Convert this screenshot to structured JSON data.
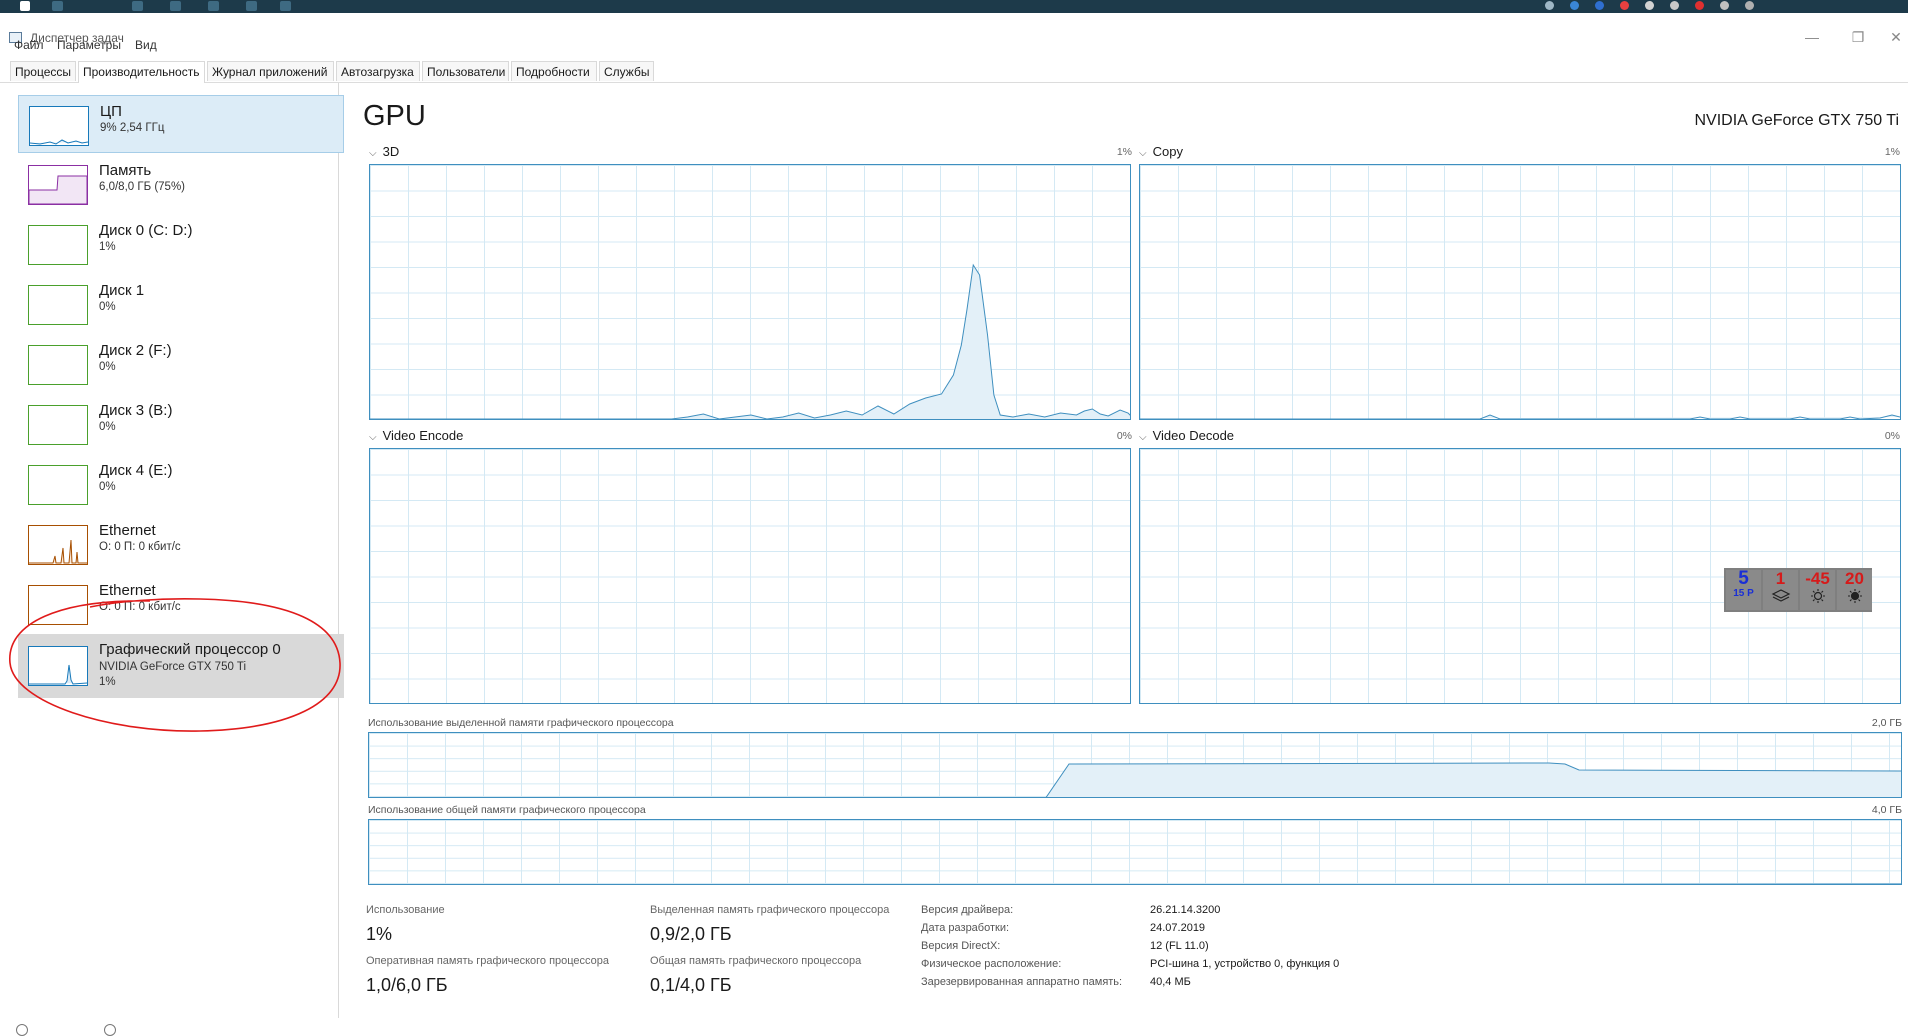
{
  "window": {
    "title": "Диспетчер задач"
  },
  "menu": [
    "Файл",
    "Параметры",
    "Вид"
  ],
  "tabs": [
    "Процессы",
    "Производительность",
    "Журнал приложений",
    "Автозагрузка",
    "Пользователи",
    "Подробности",
    "Службы"
  ],
  "sidebar": {
    "items": [
      {
        "name": "ЦП",
        "line1": "9% 2,54 ГГц",
        "color": "#1779ba"
      },
      {
        "name": "Память",
        "line1": "6,0/8,0 ГБ (75%)",
        "color": "#8b2fa3"
      },
      {
        "name": "Диск 0 (C: D:)",
        "line1": "1%",
        "color": "#4aa02c"
      },
      {
        "name": "Диск 1",
        "line1": "0%",
        "color": "#4aa02c"
      },
      {
        "name": "Диск 2 (F:)",
        "line1": "0%",
        "color": "#4aa02c"
      },
      {
        "name": "Диск 3 (B:)",
        "line1": "0%",
        "color": "#4aa02c"
      },
      {
        "name": "Диск 4 (E:)",
        "line1": "0%",
        "color": "#4aa02c"
      },
      {
        "name": "Ethernet",
        "line1": "О: 0 П: 0 кбит/с",
        "color": "#a74f01"
      },
      {
        "name": "Ethernet",
        "line1": "О: 0 П: 0 кбит/с",
        "color": "#a74f01"
      },
      {
        "name": "Графический процессор 0",
        "line1": "NVIDIA GeForce GTX 750 Ti",
        "line2": "1%",
        "color": "#1779ba"
      }
    ]
  },
  "main": {
    "title": "GPU",
    "model": "NVIDIA GeForce GTX 750 Ti",
    "graphs": [
      {
        "label": "3D",
        "pct": "1%"
      },
      {
        "label": "Copy",
        "pct": "1%"
      },
      {
        "label": "Video Encode",
        "pct": "0%"
      },
      {
        "label": "Video Decode",
        "pct": "0%"
      }
    ],
    "dedicated_mem": {
      "label": "Использование выделенной памяти графического процессора",
      "max": "2,0 ГБ"
    },
    "shared_mem": {
      "label": "Использование общей памяти графического процессора",
      "max": "4,0 ГБ"
    },
    "stats": {
      "usage_label": "Использование",
      "usage_value": "1%",
      "dedicated_label": "Выделенная память графического процессора",
      "dedicated_value": "0,9/2,0 ГБ",
      "gpu_ram_label": "Оперативная память графического процессора",
      "gpu_ram_value": "1,0/6,0 ГБ",
      "shared_label": "Общая память графического процессора",
      "shared_value": "0,1/4,0 ГБ"
    },
    "info": [
      {
        "key": "Версия драйвера:",
        "value": "26.21.14.3200"
      },
      {
        "key": "Дата разработки:",
        "value": "24.07.2019"
      },
      {
        "key": "Версия DirectX:",
        "value": "12 (FL 11.0)"
      },
      {
        "key": "Физическое расположение:",
        "value": "PCI-шина 1, устройство 0, функция 0"
      },
      {
        "key": "Зарезервированная аппаратно память:",
        "value": "40,4 МБ"
      }
    ]
  },
  "widget": {
    "cells": [
      {
        "top": "5",
        "bottom": "15 Р",
        "color": "#1a2fd6"
      },
      {
        "top": "1",
        "icon": "layers-icon",
        "color": "#d61a1a"
      },
      {
        "top": "-45",
        "icon": "sun-icon",
        "color": "#d61a1a"
      },
      {
        "top": "20",
        "icon": "sun-icon",
        "color": "#d61a1a"
      }
    ]
  }
}
